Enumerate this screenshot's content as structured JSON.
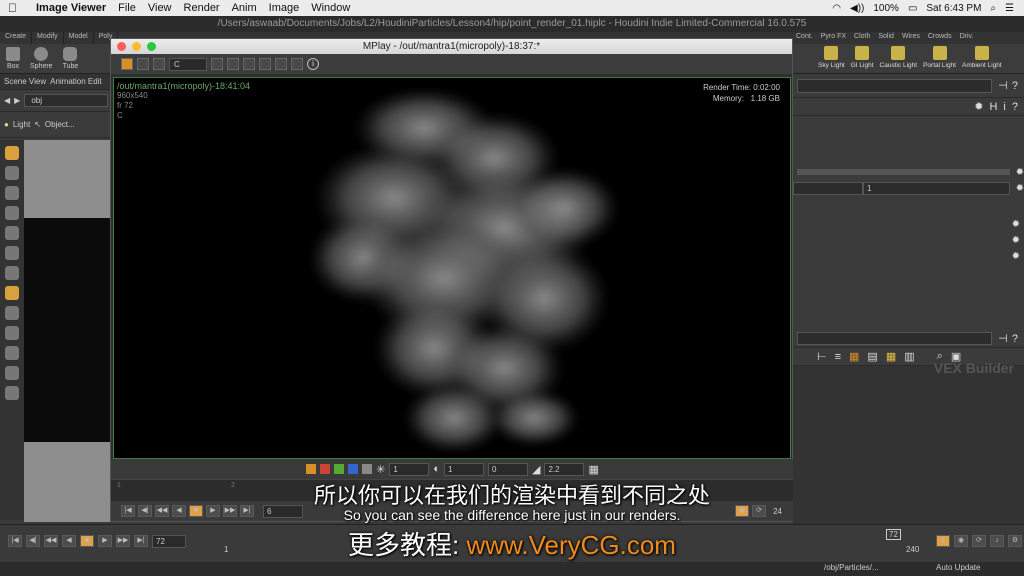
{
  "menubar": {
    "app_name": "Image Viewer",
    "items": [
      "File",
      "View",
      "Render",
      "Anim",
      "Image",
      "Window"
    ],
    "battery": "100%",
    "clock": "Sat 6:43 PM"
  },
  "window_title": "/Users/aswaab/Documents/Jobs/L2/HoudiniParticles/Lesson4/hip/point_render_01.hiplc - Houdini Indie Limited-Commercial 16.0.575",
  "shelf": {
    "tabs": [
      "Create",
      "Modify",
      "Model",
      "Poly"
    ],
    "tools": [
      "Box",
      "Sphere",
      "Tube"
    ],
    "right_tabs": [
      "Cont.",
      "Pyro FX",
      "Cloth",
      "Solid",
      "Wires",
      "Crowds",
      "Driv."
    ],
    "right_tools": [
      "Sky Light",
      "GI Light",
      "Caustic Light",
      "Portal Light",
      "Ambient Light"
    ]
  },
  "left_panel": {
    "tabs": [
      "Scene View",
      "Animation Edit"
    ],
    "path": "obj",
    "tool_label": "Light",
    "object_label": "Object..."
  },
  "mplay": {
    "title": "MPlay - /out/mantra1(micropoly)-18:37:*",
    "channel": "C",
    "render_path": "/out/mantra1(micropoly)-18:41:04",
    "resolution": "960x540",
    "frame": "fr 72",
    "channel_label": "C",
    "render_time": "Render Time: 0:02:00",
    "memory_label": "Memory:",
    "memory_value": "1.18 GB",
    "bottom_fields": [
      "1",
      "1",
      "0",
      "2.2"
    ],
    "timeline_ticks": [
      "1",
      "2"
    ],
    "current_frame": "6",
    "end_frame": "24"
  },
  "right_panel": {
    "field_value": "1",
    "network_label": "VEX Builder"
  },
  "bottom": {
    "frame_field": "72",
    "start": "1",
    "frame_marker": "72",
    "end": "240",
    "status_path": "/obj/Particles/...",
    "auto_update": "Auto Update"
  },
  "subtitles": {
    "chinese": "所以你可以在我们的渲染中看到不同之处",
    "english": "So you can see the difference here just in our renders."
  },
  "watermark": {
    "prefix": "更多教程:",
    "url": "www.VeryCG.com"
  }
}
